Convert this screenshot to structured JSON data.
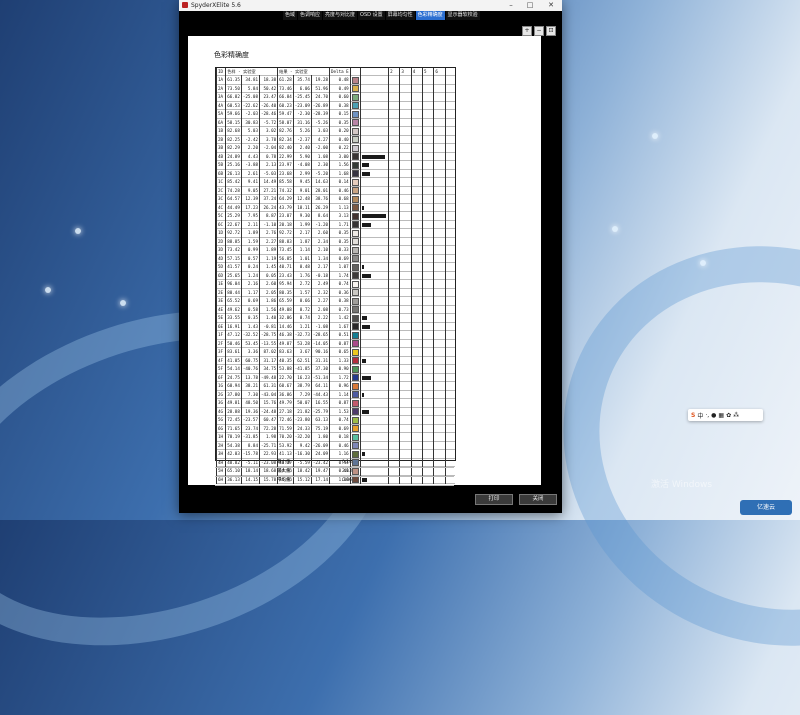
{
  "window": {
    "title": "SpyderXElite 5.6",
    "tabs": [
      {
        "label": "色域",
        "active": false
      },
      {
        "label": "色调响应",
        "active": false
      },
      {
        "label": "亮度与对比度",
        "active": false
      },
      {
        "label": "OSD 设置",
        "active": false
      },
      {
        "label": "屏幕均匀性",
        "active": false
      },
      {
        "label": "色彩精确度",
        "active": true
      },
      {
        "label": "显示器软校验",
        "active": false
      }
    ],
    "toolbar_icons": [
      "zoom-in-icon",
      "zoom-out-icon",
      "zoom-fit-icon"
    ],
    "buttons": {
      "print": "打印",
      "close": "关闭"
    }
  },
  "report": {
    "title": "色彩精确度",
    "columns": {
      "id": "ID",
      "target": "色样 - 实验室",
      "result": "结果 - 实验室",
      "delta": "Delta E"
    },
    "rows": [
      {
        "id": "1A",
        "t": [
          "61.35",
          "34.81",
          "18.38"
        ],
        "r": [
          "61.28",
          "35.74",
          "19.28"
        ],
        "d": "0.48",
        "sw": "#b8848a"
      },
      {
        "id": "2A",
        "t": [
          "73.50",
          "5.84",
          "50.42"
        ],
        "r": [
          "73.46",
          "6.06",
          "51.96"
        ],
        "d": "0.49",
        "sw": "#d8b14e"
      },
      {
        "id": "3A",
        "t": [
          "66.82",
          "-25.08",
          "23.47"
        ],
        "r": [
          "66.84",
          "-25.45",
          "24.70",
          "b"
        ],
        "d": "0.60",
        "sw": "#7dac7c"
      },
      {
        "id": "4A",
        "t": [
          "60.53",
          "-22.62",
          "-26.40"
        ],
        "r": [
          "60.23",
          "-23.09",
          "-26.89"
        ],
        "d": "0.38",
        "sw": "#4b9fb3"
      },
      {
        "id": "5A",
        "t": [
          "59.66",
          "-2.03",
          "-28.46"
        ],
        "r": [
          "59.47",
          "-2.30",
          "-28.39"
        ],
        "d": "0.15",
        "sw": "#6f93c1"
      },
      {
        "id": "6A",
        "t": [
          "58.15",
          "30.83",
          "-5.72"
        ],
        "r": [
          "58.07",
          "31.16",
          "-5.26"
        ],
        "d": "0.35",
        "sw": "#b985a7"
      },
      {
        "id": "1B",
        "t": [
          "82.68",
          "5.03",
          "3.02"
        ],
        "r": [
          "82.76",
          "5.26",
          "3.03"
        ],
        "d": "0.20",
        "sw": "#d4c8c6"
      },
      {
        "id": "2B",
        "t": [
          "82.25",
          "-2.42",
          "3.78"
        ],
        "r": [
          "82.34",
          "-2.37",
          "4.27"
        ],
        "d": "0.40",
        "sw": "#c9cec4"
      },
      {
        "id": "3B",
        "t": [
          "82.29",
          "2.20",
          "-2.04"
        ],
        "r": [
          "82.40",
          "2.40",
          "-2.00"
        ],
        "d": "0.22",
        "sw": "#cfcad0"
      },
      {
        "id": "4B",
        "t": [
          "24.89",
          "4.43",
          "0.78"
        ],
        "r": [
          "22.99",
          "5.90",
          "1.08"
        ],
        "d": "3.00",
        "sw": "#3a3635"
      },
      {
        "id": "5B",
        "t": [
          "25.16",
          "-3.88",
          "2.13"
        ],
        "r": [
          "23.97",
          "-4.08",
          "2.30"
        ],
        "d": "1.56",
        "sw": "#333a35"
      },
      {
        "id": "6B",
        "t": [
          "26.13",
          "2.61",
          "-5.03"
        ],
        "r": [
          "23.68",
          "2.99",
          "-5.20"
        ],
        "d": "1.68",
        "sw": "#363441"
      },
      {
        "id": "1C",
        "t": [
          "85.42",
          "9.41",
          "14.49"
        ],
        "r": [
          "85.58",
          "9.45",
          "14.63"
        ],
        "d": "0.14",
        "sw": "#e6cdbd"
      },
      {
        "id": "2C",
        "t": [
          "74.28",
          "9.05",
          "27.21"
        ],
        "r": [
          "74.32",
          "9.01",
          "28.01"
        ],
        "d": "0.46",
        "sw": "#caa584"
      },
      {
        "id": "3C",
        "t": [
          "64.57",
          "12.39",
          "37.24"
        ],
        "r": [
          "64.29",
          "12.48",
          "38.76"
        ],
        "d": "0.68",
        "sw": "#b48b5f"
      },
      {
        "id": "4C",
        "t": [
          "44.49",
          "17.23",
          "26.24"
        ],
        "r": [
          "43.79",
          "18.11",
          "26.29"
        ],
        "d": "1.13",
        "sw": "#7d5a43"
      },
      {
        "id": "5C",
        "t": [
          "25.29",
          "7.95",
          "8.87"
        ],
        "r": [
          "23.07",
          "9.30",
          "8.64"
        ],
        "d": "3.13",
        "sw": "#423330"
      },
      {
        "id": "6C",
        "t": [
          "22.67",
          "2.11",
          "-1.10"
        ],
        "r": [
          "20.18",
          "1.99",
          "-1.20"
        ],
        "d": "1.71",
        "sw": "#363334"
      },
      {
        "id": "1D",
        "t": [
          "92.72",
          "1.89",
          "2.76"
        ],
        "r": [
          "92.72",
          "2.17",
          "2.60"
        ],
        "d": "0.35",
        "sw": "#eeeae6"
      },
      {
        "id": "2D",
        "t": [
          "88.85",
          "1.59",
          "2.27"
        ],
        "r": [
          "88.83",
          "1.87",
          "2.34"
        ],
        "d": "0.35",
        "sw": "#e2dfdb"
      },
      {
        "id": "3D",
        "t": [
          "73.42",
          "0.99",
          "1.89"
        ],
        "r": [
          "73.45",
          "1.14",
          "2.10"
        ],
        "d": "0.33",
        "sw": "#b8b6b3"
      },
      {
        "id": "4D",
        "t": [
          "57.15",
          "0.57",
          "1.19"
        ],
        "r": [
          "56.85",
          "1.01",
          "1.34"
        ],
        "d": "0.69",
        "sw": "#8b8a88"
      },
      {
        "id": "5D",
        "t": [
          "41.57",
          "0.24",
          "1.45"
        ],
        "r": [
          "40.71",
          "0.48",
          "2.17"
        ],
        "d": "1.07",
        "sw": "#636260"
      },
      {
        "id": "6D",
        "t": [
          "25.65",
          "1.24",
          "0.05"
        ],
        "r": [
          "23.43",
          "1.76",
          "-0.18"
        ],
        "d": "1.74",
        "sw": "#3d3b3b"
      },
      {
        "id": "1E",
        "t": [
          "96.04",
          "2.16",
          "2.60"
        ],
        "r": [
          "95.94",
          "2.72",
          "2.49"
        ],
        "d": "0.74",
        "sw": "#f7f4f0"
      },
      {
        "id": "2E",
        "t": [
          "80.44",
          "1.17",
          "2.05"
        ],
        "r": [
          "80.35",
          "1.57",
          "2.32"
        ],
        "d": "0.36",
        "sw": "#cbc9c5"
      },
      {
        "id": "3E",
        "t": [
          "65.52",
          "0.69",
          "1.86"
        ],
        "r": [
          "65.59",
          "0.66",
          "2.27"
        ],
        "d": "0.38",
        "sw": "#a09e9b"
      },
      {
        "id": "4E",
        "t": [
          "49.62",
          "0.58",
          "1.56"
        ],
        "r": [
          "49.08",
          "0.72",
          "2.08"
        ],
        "d": "0.73",
        "sw": "#767573"
      },
      {
        "id": "5E",
        "t": [
          "33.55",
          "0.35",
          "1.40"
        ],
        "r": [
          "32.06",
          "0.74",
          "2.22"
        ],
        "d": "1.42",
        "sw": "#4e4d4c"
      },
      {
        "id": "6E",
        "t": [
          "16.91",
          "1.43",
          "-0.81"
        ],
        "r": [
          "14.46",
          "1.21",
          "-1.08"
        ],
        "d": "1.67",
        "sw": "#292829"
      },
      {
        "id": "1F",
        "t": [
          "47.12",
          "-32.52",
          "-28.75"
        ],
        "r": [
          "46.38",
          "-32.73",
          "-28.65"
        ],
        "d": "0.51",
        "sw": "#157e92"
      },
      {
        "id": "2F",
        "t": [
          "50.46",
          "53.45",
          "-13.55"
        ],
        "r": [
          "49.87",
          "53.28",
          "-14.05"
        ],
        "d": "0.87",
        "sw": "#a94b8a"
      },
      {
        "id": "3F",
        "t": [
          "83.61",
          "3.36",
          "87.02"
        ],
        "r": [
          "83.63",
          "3.67",
          "90.16"
        ],
        "d": "0.65",
        "sw": "#ecc71e"
      },
      {
        "id": "4F",
        "t": [
          "41.05",
          "60.75",
          "31.17"
        ],
        "r": [
          "40.35",
          "62.51",
          "31.31"
        ],
        "d": "1.33",
        "sw": "#b32d3d"
      },
      {
        "id": "5F",
        "t": [
          "54.14",
          "-40.76",
          "34.75"
        ],
        "r": [
          "53.88",
          "-41.85",
          "37.30"
        ],
        "d": "0.90",
        "sw": "#4f955a"
      },
      {
        "id": "6F",
        "t": [
          "24.75",
          "13.78",
          "-49.48"
        ],
        "r": [
          "22.70",
          "16.23",
          "-51.34"
        ],
        "d": "1.72",
        "sw": "#243a8c"
      },
      {
        "id": "1G",
        "t": [
          "60.94",
          "38.21",
          "61.31"
        ],
        "r": [
          "60.67",
          "38.79",
          "64.11"
        ],
        "d": "0.96",
        "sw": "#d87a3a"
      },
      {
        "id": "2G",
        "t": [
          "37.80",
          "7.30",
          "-43.04"
        ],
        "r": [
          "36.86",
          "7.29",
          "-44.43"
        ],
        "d": "1.14",
        "sw": "#4d5aa1"
      },
      {
        "id": "3G",
        "t": [
          "49.81",
          "48.50",
          "15.76"
        ],
        "r": [
          "49.79",
          "50.07",
          "16.55"
        ],
        "d": "0.87",
        "sw": "#c15a6c"
      },
      {
        "id": "4G",
        "t": [
          "28.88",
          "19.36",
          "-24.48"
        ],
        "r": [
          "27.18",
          "21.82",
          "-25.79"
        ],
        "d": "1.53",
        "sw": "#4f3a6a"
      },
      {
        "id": "5G",
        "t": [
          "72.45",
          "-23.57",
          "60.47"
        ],
        "r": [
          "72.46",
          "-23.80",
          "63.13"
        ],
        "d": "0.74",
        "sw": "#9dbb48"
      },
      {
        "id": "6G",
        "t": [
          "71.65",
          "23.74",
          "72.28"
        ],
        "r": [
          "71.59",
          "24.33",
          "75.19"
        ],
        "d": "0.69",
        "sw": "#e69f2e"
      },
      {
        "id": "1H",
        "t": [
          "70.19",
          "-31.85",
          "1.98"
        ],
        "r": [
          "70.20",
          "-32.20",
          "1.80"
        ],
        "d": "0.18",
        "sw": "#5bbfa0"
      },
      {
        "id": "2H",
        "t": [
          "54.38",
          "8.84",
          "-25.71"
        ],
        "r": [
          "53.92",
          "9.42",
          "-26.09"
        ],
        "d": "0.46",
        "sw": "#7e86b6"
      },
      {
        "id": "3H",
        "t": [
          "42.03",
          "-15.78",
          "22.93"
        ],
        "r": [
          "41.13",
          "-16.30",
          "24.09"
        ],
        "d": "1.16",
        "sw": "#5f6d3c"
      },
      {
        "id": "4H",
        "t": [
          "48.82",
          "-5.11",
          "-23.08"
        ],
        "r": [
          "48.37",
          "-5.59",
          "-23.42"
        ],
        "d": "0.44",
        "sw": "#5f7596"
      },
      {
        "id": "5H",
        "t": [
          "65.10",
          "18.14",
          "18.68"
        ],
        "r": [
          "64.95",
          "18.42",
          "19.47"
        ],
        "d": "0.40",
        "sw": "#be9184"
      },
      {
        "id": "6H",
        "t": [
          "36.13",
          "14.15",
          "15.78"
        ],
        "r": [
          "34.95",
          "15.12",
          "17.14"
        ],
        "d": "1.36",
        "sw": "#6f4c3e"
      }
    ],
    "summary": [
      {
        "label": "最小值:",
        "value": "0.14"
      },
      {
        "label": "最大值:",
        "value": "3.13"
      },
      {
        "label": "平均值:",
        "value": "0.86"
      }
    ]
  },
  "taskbar": {
    "ime": {
      "logo": "S",
      "lang": "中",
      "items": [
        "·,",
        "mic-icon",
        "keyboard-icon",
        "skin-icon",
        "grid-icon"
      ]
    },
    "watermark": "激活 Windows",
    "corner_logo": "亿速云"
  }
}
